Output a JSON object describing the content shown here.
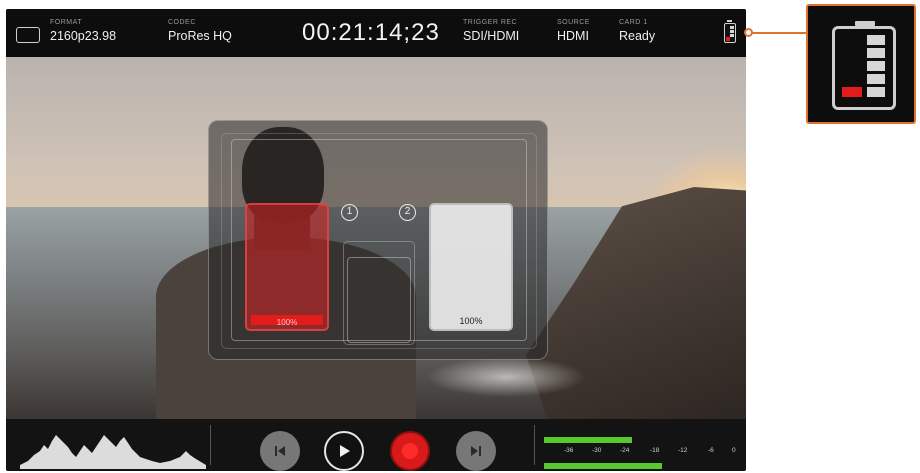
{
  "topbar": {
    "format_label": "FORMAT",
    "format_value": "2160p23.98",
    "codec_label": "CODEC",
    "codec_value": "ProRes HQ",
    "timecode": "00:21:14;23",
    "trigger_label": "TRIGGER REC",
    "trigger_value": "SDI/HDMI",
    "source_label": "SOURCE",
    "source_value": "HDMI",
    "card_label": "CARD 1",
    "card_value": "Ready"
  },
  "storage": {
    "slot1_number": "1",
    "slot2_number": "2",
    "slot1_percent": "100%",
    "slot2_percent": "100%"
  },
  "audio_meter": {
    "ticks": [
      "-36",
      "-30",
      "-24",
      "-18",
      "-12",
      "-6",
      "0"
    ]
  },
  "colors": {
    "accent": "#e0722f",
    "record_red": "#d81a1a",
    "meter_green": "#59c82c"
  },
  "icons": [
    "display-icon",
    "battery-icon",
    "skip-back-icon",
    "play-icon",
    "record-icon",
    "skip-forward-icon"
  ]
}
